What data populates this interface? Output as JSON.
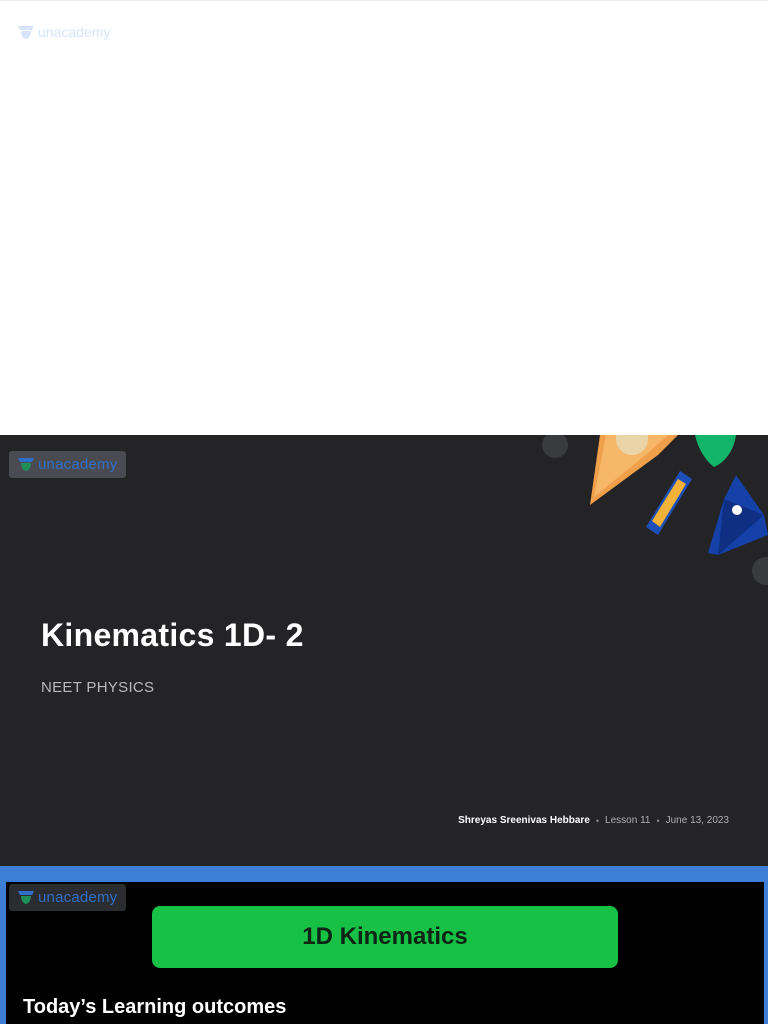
{
  "brand": {
    "name": "unacademy",
    "accent": "#2f6fc9",
    "logo_icon": "unacademy-logo-icon"
  },
  "title_slide": {
    "title": "Kinematics 1D- 2",
    "subtitle": "NEET PHYSICS",
    "author": "Shreyas Sreenivas Hebbare",
    "separator": "•",
    "lesson": "Lesson 11",
    "date": "June 13, 2023",
    "background": "#242426"
  },
  "lesson_slide": {
    "banner": "1D Kinematics",
    "heading": "Today’s Learning outcomes",
    "banner_color": "#16c146",
    "frame_color": "#3d7fd6"
  }
}
